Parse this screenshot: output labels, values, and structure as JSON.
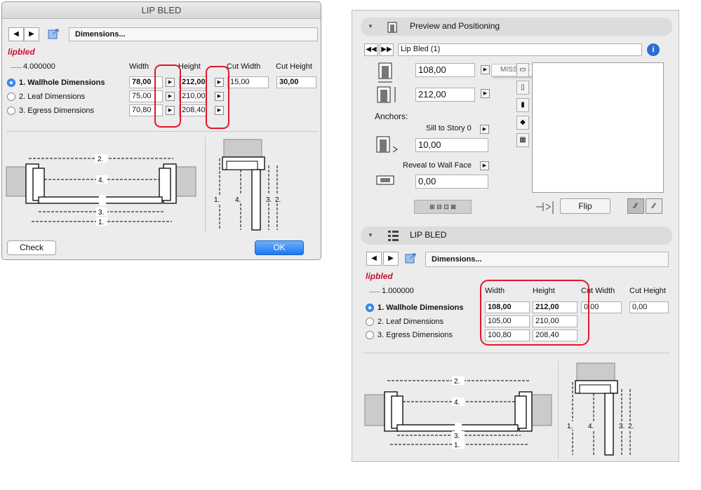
{
  "left_dialog": {
    "title": "LIP BLED",
    "nav": {
      "prev": "◀",
      "next": "▶",
      "page_label": "Dimensions..."
    },
    "logo": "lipbled",
    "scale": "4.000000",
    "headers": {
      "width": "Width",
      "height": "Height",
      "cut_width": "Cut Width",
      "cut_height": "Cut Height"
    },
    "rows": [
      {
        "label": "1. Wallhole Dimensions",
        "width": "78,00",
        "height": "212,00",
        "selected": true
      },
      {
        "label": "2. Leaf Dimensions",
        "width": "75,00",
        "height": "210,00",
        "selected": false
      },
      {
        "label": "3. Egress Dimensions",
        "width": "70,80",
        "height": "208,40",
        "selected": false
      }
    ],
    "cut_width": "15,00",
    "cut_height": "30,00",
    "buttons": {
      "check": "Check",
      "ok": "OK"
    }
  },
  "right_panel": {
    "preview_section": {
      "title": "Preview and Positioning",
      "object_name": "Lip Bled (1)",
      "info_icon": "i",
      "width_value": "108,00",
      "height_value": "212,00",
      "missing_text": "MISSING",
      "anchors_label": "Anchors:",
      "sill_label": "Sill to Story 0",
      "sill_value": "10,00",
      "reveal_label": "Reveal to Wall Face",
      "reveal_value": "0,00",
      "flip_label": "Flip"
    },
    "lip_section": {
      "title": "LIP BLED",
      "nav": {
        "prev": "◀",
        "next": "▶",
        "page_label": "Dimensions..."
      },
      "logo": "lipbled",
      "scale": "1.000000",
      "headers": {
        "width": "Width",
        "height": "Height",
        "cut_width": "Cut Width",
        "cut_height": "Cut Height"
      },
      "rows": [
        {
          "label": "1. Wallhole Dimensions",
          "width": "108,00",
          "height": "212,00",
          "selected": true
        },
        {
          "label": "2. Leaf Dimensions",
          "width": "105,00",
          "height": "210,00",
          "selected": false
        },
        {
          "label": "3. Egress Dimensions",
          "width": "100,80",
          "height": "208,40",
          "selected": false
        }
      ],
      "cut_width": "0,00",
      "cut_height": "0,00"
    }
  },
  "diagram": {
    "h_labels": [
      "2.",
      "4.",
      "3.",
      "1."
    ],
    "v_labels": [
      "1.",
      "4.",
      "3.",
      "2."
    ]
  }
}
